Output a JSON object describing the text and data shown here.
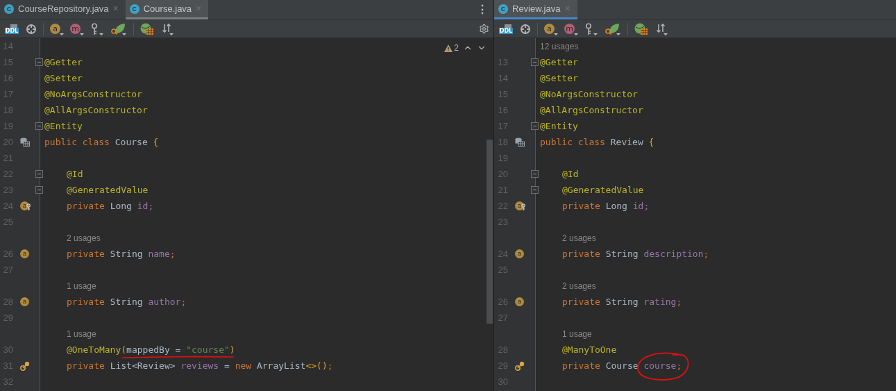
{
  "panes": [
    {
      "focused": false,
      "tabs": [
        {
          "icon_glyph": "C",
          "label": "CourseRepository.java",
          "close": "×",
          "selected": false
        },
        {
          "icon_glyph": "C",
          "label": "Course.java",
          "close": "×",
          "selected": true
        }
      ],
      "menu": "⋮",
      "toolbar": [
        {
          "kind": "ddl",
          "glyph": "DDL"
        },
        {
          "kind": "target"
        },
        {
          "kind": "sep"
        },
        {
          "kind": "badge",
          "glyph": "a",
          "color": "#b08a3e"
        },
        {
          "kind": "badge",
          "glyph": "m",
          "color": "#b05f74"
        },
        {
          "kind": "key"
        },
        {
          "kind": "leaf"
        },
        {
          "kind": "sep"
        },
        {
          "kind": "globe"
        },
        {
          "kind": "sort"
        }
      ],
      "settings": true,
      "inspections": {
        "count": "2"
      },
      "scrollbar": true,
      "lines": [
        {
          "kind": "code",
          "number": "14"
        },
        {
          "kind": "code",
          "number": "15",
          "fold": true,
          "indent": false,
          "tokens": [
            {
              "kind": "annotation",
              "text": "@Getter"
            }
          ]
        },
        {
          "kind": "code",
          "number": "16",
          "indent": false,
          "tokens": [
            {
              "kind": "annotation",
              "text": "@Setter"
            }
          ]
        },
        {
          "kind": "code",
          "number": "17",
          "indent": false,
          "tokens": [
            {
              "kind": "annotation",
              "text": "@NoArgsConstructor"
            }
          ]
        },
        {
          "kind": "code",
          "number": "18",
          "indent": false,
          "tokens": [
            {
              "kind": "annotation",
              "text": "@AllArgsConstructor"
            }
          ]
        },
        {
          "kind": "code",
          "number": "19",
          "fold": true,
          "indent": false,
          "tokens": [
            {
              "kind": "annotation",
              "text": "@Entity"
            }
          ]
        },
        {
          "kind": "code",
          "number": "20",
          "gutter": {
            "kind": "entity"
          },
          "indent": false,
          "tokens": [
            {
              "kind": "keyword",
              "text": "public class "
            },
            {
              "kind": "plain",
              "text": "Course "
            },
            {
              "kind": "bracket",
              "text": "{"
            }
          ]
        },
        {
          "kind": "code",
          "number": "21"
        },
        {
          "kind": "code",
          "number": "22",
          "fold": true,
          "indent": true,
          "tokens": [
            {
              "kind": "annotation",
              "text": "@Id"
            }
          ]
        },
        {
          "kind": "code",
          "number": "23",
          "fold": true,
          "indent": true,
          "tokens": [
            {
              "kind": "annotation",
              "text": "@GeneratedValue"
            }
          ]
        },
        {
          "kind": "code",
          "number": "24",
          "gutter": {
            "kind": "field-id",
            "glyph": "a"
          },
          "indent": true,
          "tokens": [
            {
              "kind": "keyword",
              "text": "private "
            },
            {
              "kind": "plain",
              "text": "Long "
            },
            {
              "kind": "field",
              "text": "id;"
            }
          ]
        },
        {
          "kind": "code",
          "number": "25"
        },
        {
          "kind": "usages",
          "text": "2 usages",
          "indent": true
        },
        {
          "kind": "code",
          "number": "26",
          "gutter": {
            "kind": "field",
            "glyph": "a"
          },
          "indent": true,
          "tokens": [
            {
              "kind": "keyword",
              "text": "private "
            },
            {
              "kind": "plain",
              "text": "String "
            },
            {
              "kind": "field",
              "text": "name"
            },
            {
              "kind": "keyword",
              "text": ";"
            }
          ]
        },
        {
          "kind": "code",
          "number": "27"
        },
        {
          "kind": "usages",
          "text": "1 usage",
          "indent": true
        },
        {
          "kind": "code",
          "number": "28",
          "gutter": {
            "kind": "field",
            "glyph": "a"
          },
          "indent": true,
          "tokens": [
            {
              "kind": "keyword",
              "text": "private "
            },
            {
              "kind": "plain",
              "text": "String "
            },
            {
              "kind": "field",
              "text": "author"
            },
            {
              "kind": "keyword",
              "text": ";"
            }
          ]
        },
        {
          "kind": "code",
          "number": "29"
        },
        {
          "kind": "usages",
          "text": "1 usage",
          "indent": true
        },
        {
          "kind": "code",
          "number": "30",
          "indent": true,
          "tokens": [
            {
              "kind": "annotation",
              "text": "@OneToMany"
            },
            {
              "kind": "underline",
              "tokens": [
                {
                  "kind": "bracket",
                  "text": "("
                },
                {
                  "kind": "plain",
                  "text": "mappedBy = "
                },
                {
                  "kind": "string",
                  "text": "\"course\""
                },
                {
                  "kind": "bracket",
                  "text": ")"
                }
              ]
            }
          ]
        },
        {
          "kind": "code",
          "number": "31",
          "gutter": {
            "kind": "relation"
          },
          "indent": true,
          "tokens": [
            {
              "kind": "keyword",
              "text": "private "
            },
            {
              "kind": "plain",
              "text": "List<Review> "
            },
            {
              "kind": "field",
              "text": "reviews"
            },
            {
              "kind": "plain",
              "text": " = "
            },
            {
              "kind": "keyword",
              "text": "new "
            },
            {
              "kind": "plain",
              "text": "ArrayList"
            },
            {
              "kind": "bracket",
              "text": "<>()"
            },
            {
              "kind": "keyword",
              "text": ";"
            }
          ]
        },
        {
          "kind": "code",
          "number": "32"
        }
      ]
    },
    {
      "focused": true,
      "tabs": [
        {
          "icon_glyph": "C",
          "label": "Review.java",
          "close": "×",
          "selected": true
        }
      ],
      "toolbar": [
        {
          "kind": "ddl",
          "glyph": "DDL"
        },
        {
          "kind": "target"
        },
        {
          "kind": "sep"
        },
        {
          "kind": "badge",
          "glyph": "a",
          "color": "#b08a3e"
        },
        {
          "kind": "badge",
          "glyph": "m",
          "color": "#b05f74"
        },
        {
          "kind": "key"
        },
        {
          "kind": "leaf"
        },
        {
          "kind": "sep"
        },
        {
          "kind": "globe"
        },
        {
          "kind": "sort"
        }
      ],
      "settings": false,
      "scrollbar": false,
      "lines": [
        {
          "kind": "usages",
          "text": "12 usages",
          "indent": false
        },
        {
          "kind": "code",
          "number": "13",
          "fold": true,
          "indent": false,
          "tokens": [
            {
              "kind": "annotation",
              "text": "@Getter"
            }
          ]
        },
        {
          "kind": "code",
          "number": "14",
          "indent": false,
          "tokens": [
            {
              "kind": "annotation",
              "text": "@Setter"
            }
          ]
        },
        {
          "kind": "code",
          "number": "15",
          "indent": false,
          "tokens": [
            {
              "kind": "annotation",
              "text": "@NoArgsConstructor"
            }
          ]
        },
        {
          "kind": "code",
          "number": "16",
          "indent": false,
          "tokens": [
            {
              "kind": "annotation",
              "text": "@AllArgsConstructor"
            }
          ]
        },
        {
          "kind": "code",
          "number": "17",
          "fold": true,
          "indent": false,
          "tokens": [
            {
              "kind": "annotation",
              "text": "@Entity"
            }
          ]
        },
        {
          "kind": "code",
          "number": "18",
          "gutter": {
            "kind": "entity"
          },
          "indent": false,
          "tokens": [
            {
              "kind": "keyword",
              "text": "public class "
            },
            {
              "kind": "plain",
              "text": "Review "
            },
            {
              "kind": "bracket",
              "text": "{"
            }
          ]
        },
        {
          "kind": "code",
          "number": "19"
        },
        {
          "kind": "code",
          "number": "20",
          "fold": true,
          "indent": true,
          "tokens": [
            {
              "kind": "annotation",
              "text": "@Id"
            }
          ]
        },
        {
          "kind": "code",
          "number": "21",
          "fold": true,
          "indent": true,
          "tokens": [
            {
              "kind": "annotation",
              "text": "@GeneratedValue"
            }
          ]
        },
        {
          "kind": "code",
          "number": "22",
          "gutter": {
            "kind": "field-id",
            "glyph": "a"
          },
          "indent": true,
          "tokens": [
            {
              "kind": "keyword",
              "text": "private "
            },
            {
              "kind": "plain",
              "text": "Long "
            },
            {
              "kind": "field",
              "text": "id;"
            }
          ]
        },
        {
          "kind": "code",
          "number": "23"
        },
        {
          "kind": "usages",
          "text": "2 usages",
          "indent": true
        },
        {
          "kind": "code",
          "number": "24",
          "gutter": {
            "kind": "field",
            "glyph": "a"
          },
          "indent": true,
          "tokens": [
            {
              "kind": "keyword",
              "text": "private "
            },
            {
              "kind": "plain",
              "text": "String "
            },
            {
              "kind": "field",
              "text": "description"
            },
            {
              "kind": "keyword",
              "text": ";"
            }
          ]
        },
        {
          "kind": "code",
          "number": "25"
        },
        {
          "kind": "usages",
          "text": "2 usages",
          "indent": true
        },
        {
          "kind": "code",
          "number": "26",
          "gutter": {
            "kind": "field",
            "glyph": "a"
          },
          "indent": true,
          "tokens": [
            {
              "kind": "keyword",
              "text": "private "
            },
            {
              "kind": "plain",
              "text": "String "
            },
            {
              "kind": "field",
              "text": "rating"
            },
            {
              "kind": "keyword",
              "text": ";"
            }
          ]
        },
        {
          "kind": "code",
          "number": "27"
        },
        {
          "kind": "usages",
          "text": "1 usage",
          "indent": true
        },
        {
          "kind": "code",
          "number": "28",
          "indent": true,
          "tokens": [
            {
              "kind": "annotation",
              "text": "@ManyToOne"
            }
          ]
        },
        {
          "kind": "code",
          "number": "29",
          "gutter": {
            "kind": "relation"
          },
          "indent": true,
          "tokens": [
            {
              "kind": "keyword",
              "text": "private "
            },
            {
              "kind": "plain",
              "text": "Course "
            },
            {
              "kind": "circle",
              "tokens": [
                {
                  "kind": "field",
                  "text": "course"
                },
                {
                  "kind": "keyword",
                  "text": ";"
                }
              ]
            }
          ]
        },
        {
          "kind": "code",
          "number": "30"
        }
      ]
    }
  ]
}
